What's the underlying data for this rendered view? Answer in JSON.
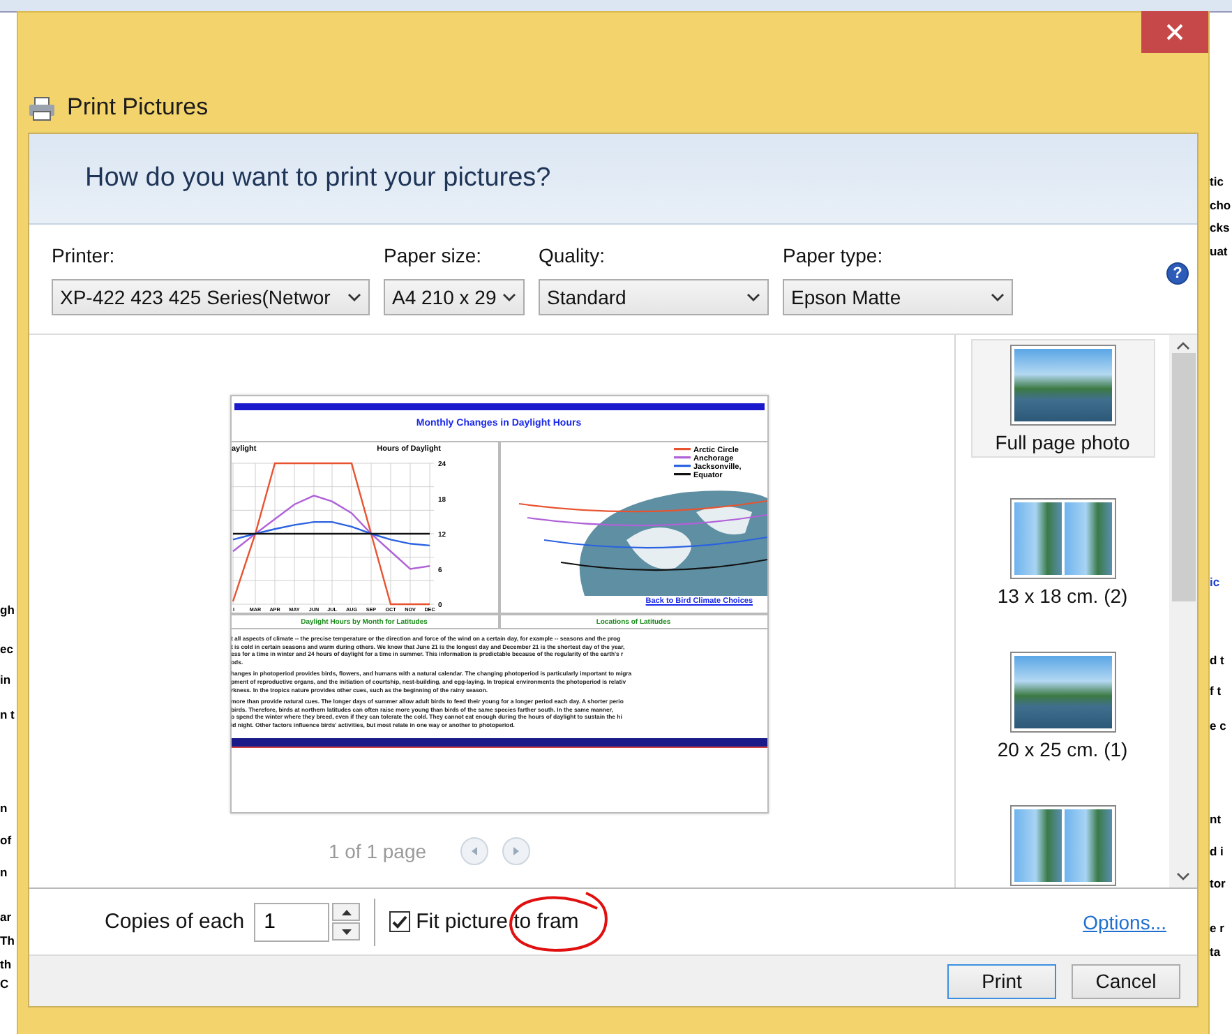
{
  "background": {
    "left_fragments": [
      "gh",
      "ec",
      "in",
      "n t",
      "n",
      "of",
      "n",
      "ar",
      "Th",
      "th",
      "C"
    ],
    "right_fragments": [
      "tic",
      "cho",
      "cks",
      "uat",
      "ic",
      "d t",
      "f t",
      "e c",
      "nt",
      "d i",
      "tor",
      "e r",
      "ta"
    ]
  },
  "window": {
    "title": "Print Pictures"
  },
  "heading": "How do you want to print your pictures?",
  "help": "?",
  "options": [
    {
      "label": "Printer:",
      "value": "XP-422 423 425 Series(Networ"
    },
    {
      "label": "Paper size:",
      "value": "A4 210 x 29"
    },
    {
      "label": "Quality:",
      "value": "Standard"
    },
    {
      "label": "Paper type:",
      "value": "Epson Matte"
    }
  ],
  "preview": {
    "title": "Monthly Changes in Daylight Hours",
    "chart_left_label": "aylight",
    "chart_right_label": "Hours of Daylight",
    "chart_data": {
      "type": "line",
      "categories": [
        "I",
        "MAR",
        "APR",
        "MAY",
        "JUN",
        "JUL",
        "AUG",
        "SEP",
        "OCT",
        "NOV",
        "DEC"
      ],
      "series": [
        {
          "color": "#e8532f",
          "values": [
            0.5,
            12,
            24,
            24,
            24,
            24,
            24,
            12,
            0,
            0,
            0
          ]
        },
        {
          "color": "#b062d8",
          "values": [
            9,
            12,
            14.5,
            17,
            18.5,
            17.5,
            15.5,
            12,
            9,
            6,
            6.5
          ]
        },
        {
          "color": "#2a62e0",
          "values": [
            11,
            12,
            12.8,
            13.5,
            14,
            14,
            13.2,
            12,
            11,
            10.3,
            10
          ]
        },
        {
          "color": "#111111",
          "values": [
            12,
            12,
            12,
            12,
            12,
            12,
            12,
            12,
            12,
            12,
            12
          ]
        }
      ],
      "ylim": [
        0,
        24
      ],
      "yticks": [
        0,
        6,
        12,
        18,
        24
      ],
      "grid": true
    },
    "legend": [
      {
        "label": "Arctic Circle",
        "color": "#e8532f"
      },
      {
        "label": "Anchorage",
        "color": "#b062d8"
      },
      {
        "label": "Jacksonville,",
        "color": "#2a62e0"
      },
      {
        "label": "Equator",
        "color": "#111111"
      }
    ],
    "link": "Back to Bird Climate Choices",
    "captions": [
      "Daylight Hours by Month for Latitudes",
      "Locations of Latitudes"
    ],
    "paragraphs": [
      [
        "t all aspects of climate -- the precise temperature or the direction and force of the wind on a certain day, for example -- seasons and the prog",
        "t is cold in certain seasons and warm during others. We know that June 21 is the longest day and December 21 is the shortest day of the year,",
        "ess for a time in winter and 24 hours of daylight for a time in summer. This information is predictable because of the regularity of the earth's r",
        "ods."
      ],
      [
        "hanges in photoperiod provides birds, flowers, and humans with a natural calendar. The changing photoperiod is particularly important to migra",
        "pment of reproductive organs, and the initiation of courtship, nest-building, and egg-laying. In tropical environments the photoperiod is relativ",
        "rkness. In the tropics nature provides other cues, such as the beginning of the rainy season."
      ],
      [
        "more than provide natural cues. The longer days of summer allow adult birds to feed their young for a longer period each day. A shorter perio",
        "birds. Therefore, birds at northern latitudes can often raise more young than birds of the same species farther south. In the same manner,",
        "o spend the winter where they breed, even if they can tolerate the cold. They cannot eat enough during the hours of daylight to sustain the hi",
        "id night. Other factors influence birds' activities, but most relate in one way or another to photoperiod."
      ]
    ],
    "page_status": "1 of 1 page"
  },
  "layouts": [
    {
      "label": "Full page photo",
      "kind": "single",
      "selected": true
    },
    {
      "label": "13 x 18 cm. (2)",
      "kind": "pair",
      "selected": false
    },
    {
      "label": "20 x 25 cm. (1)",
      "kind": "single",
      "selected": false
    },
    {
      "kind": "pair",
      "selected": false
    }
  ],
  "copies": {
    "label": "Copies of each",
    "value": "1"
  },
  "fit": {
    "label": "Fit picture to fram",
    "checked": true
  },
  "options_link": "Options...",
  "buttons": [
    {
      "label": "Print",
      "default": true
    },
    {
      "label": "Cancel",
      "default": false
    }
  ]
}
